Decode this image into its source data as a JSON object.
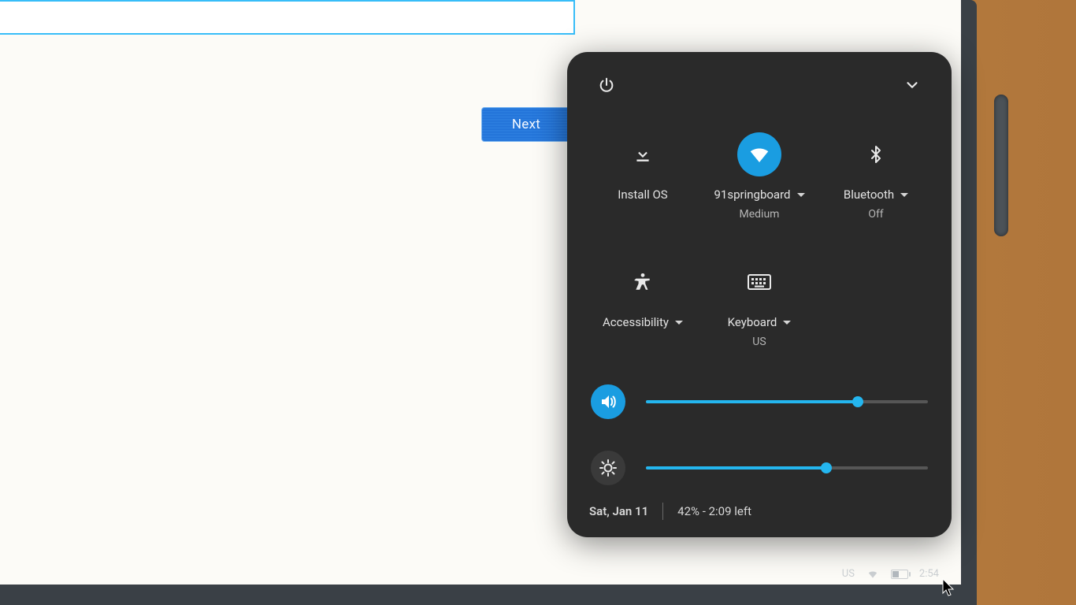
{
  "background": {
    "next_button_label": "Next"
  },
  "panel": {
    "tiles": {
      "install": {
        "label": "Install OS"
      },
      "wifi": {
        "label": "91springboard",
        "sub": "Medium",
        "active": true
      },
      "bluetooth": {
        "label": "Bluetooth",
        "sub": "Off"
      },
      "accessibility": {
        "label": "Accessibility"
      },
      "keyboard": {
        "label": "Keyboard",
        "sub": "US"
      }
    },
    "sliders": {
      "volume_percent": 75,
      "brightness_percent": 64
    },
    "footer": {
      "date": "Sat, Jan 11",
      "battery": "42% - 2:09 left"
    }
  },
  "tray": {
    "ime": "US",
    "time": "2:54"
  }
}
